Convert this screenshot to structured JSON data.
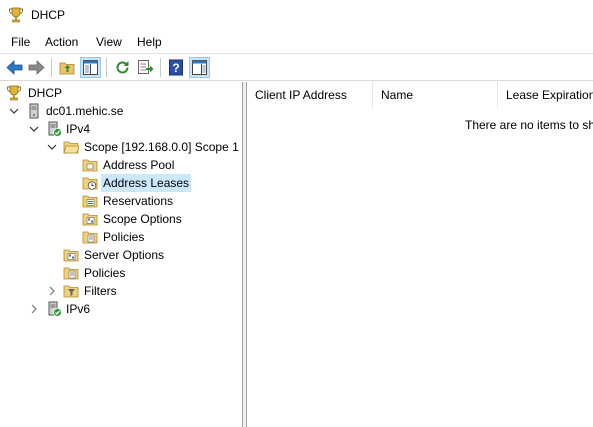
{
  "window": {
    "title": "DHCP"
  },
  "menu": {
    "items": [
      "File",
      "Action",
      "View",
      "Help"
    ]
  },
  "toolbar": {
    "buttons": [
      "back-arrow-icon",
      "forward-arrow-icon",
      "up-folder-icon",
      "show-hide-tree-icon",
      "refresh-icon",
      "export-list-icon",
      "help-icon",
      "action-pane-icon"
    ]
  },
  "tree": {
    "root": "DHCP",
    "server": "dc01.mehic.se",
    "ipv4": "IPv4",
    "scope": "Scope [192.168.0.0] Scope 1",
    "address_pool": "Address Pool",
    "address_leases": "Address Leases",
    "reservations": "Reservations",
    "scope_options": "Scope Options",
    "scope_policies": "Policies",
    "server_options": "Server Options",
    "policies": "Policies",
    "filters": "Filters",
    "ipv6": "IPv6",
    "selected": "Address Leases"
  },
  "list": {
    "columns": [
      "Client IP Address",
      "Name",
      "Lease Expiration"
    ],
    "empty_message": "There are no items to show in this view."
  }
}
